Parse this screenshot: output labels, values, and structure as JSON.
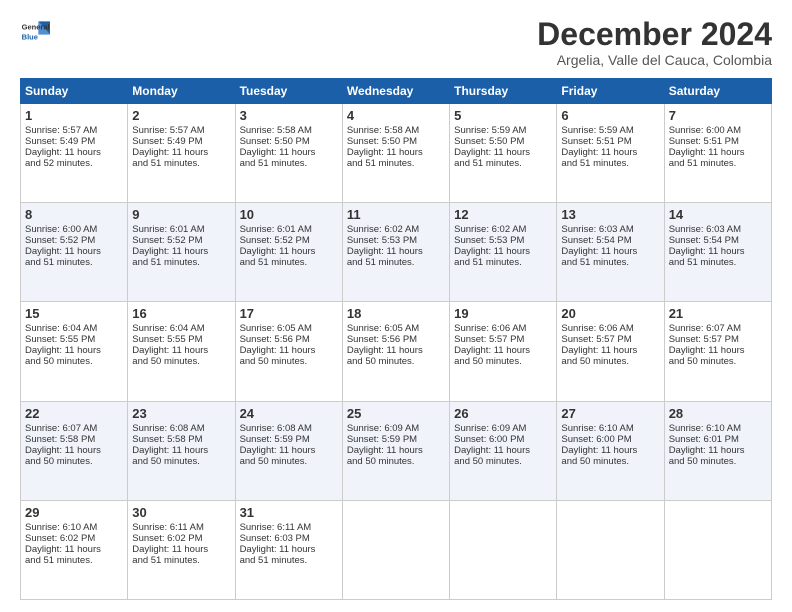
{
  "header": {
    "logo_line1": "General",
    "logo_line2": "Blue",
    "month": "December 2024",
    "location": "Argelia, Valle del Cauca, Colombia"
  },
  "days_of_week": [
    "Sunday",
    "Monday",
    "Tuesday",
    "Wednesday",
    "Thursday",
    "Friday",
    "Saturday"
  ],
  "weeks": [
    [
      {
        "day": 1,
        "lines": [
          "Sunrise: 5:57 AM",
          "Sunset: 5:49 PM",
          "Daylight: 11 hours",
          "and 52 minutes."
        ]
      },
      {
        "day": 2,
        "lines": [
          "Sunrise: 5:57 AM",
          "Sunset: 5:49 PM",
          "Daylight: 11 hours",
          "and 51 minutes."
        ]
      },
      {
        "day": 3,
        "lines": [
          "Sunrise: 5:58 AM",
          "Sunset: 5:50 PM",
          "Daylight: 11 hours",
          "and 51 minutes."
        ]
      },
      {
        "day": 4,
        "lines": [
          "Sunrise: 5:58 AM",
          "Sunset: 5:50 PM",
          "Daylight: 11 hours",
          "and 51 minutes."
        ]
      },
      {
        "day": 5,
        "lines": [
          "Sunrise: 5:59 AM",
          "Sunset: 5:50 PM",
          "Daylight: 11 hours",
          "and 51 minutes."
        ]
      },
      {
        "day": 6,
        "lines": [
          "Sunrise: 5:59 AM",
          "Sunset: 5:51 PM",
          "Daylight: 11 hours",
          "and 51 minutes."
        ]
      },
      {
        "day": 7,
        "lines": [
          "Sunrise: 6:00 AM",
          "Sunset: 5:51 PM",
          "Daylight: 11 hours",
          "and 51 minutes."
        ]
      }
    ],
    [
      {
        "day": 8,
        "lines": [
          "Sunrise: 6:00 AM",
          "Sunset: 5:52 PM",
          "Daylight: 11 hours",
          "and 51 minutes."
        ]
      },
      {
        "day": 9,
        "lines": [
          "Sunrise: 6:01 AM",
          "Sunset: 5:52 PM",
          "Daylight: 11 hours",
          "and 51 minutes."
        ]
      },
      {
        "day": 10,
        "lines": [
          "Sunrise: 6:01 AM",
          "Sunset: 5:52 PM",
          "Daylight: 11 hours",
          "and 51 minutes."
        ]
      },
      {
        "day": 11,
        "lines": [
          "Sunrise: 6:02 AM",
          "Sunset: 5:53 PM",
          "Daylight: 11 hours",
          "and 51 minutes."
        ]
      },
      {
        "day": 12,
        "lines": [
          "Sunrise: 6:02 AM",
          "Sunset: 5:53 PM",
          "Daylight: 11 hours",
          "and 51 minutes."
        ]
      },
      {
        "day": 13,
        "lines": [
          "Sunrise: 6:03 AM",
          "Sunset: 5:54 PM",
          "Daylight: 11 hours",
          "and 51 minutes."
        ]
      },
      {
        "day": 14,
        "lines": [
          "Sunrise: 6:03 AM",
          "Sunset: 5:54 PM",
          "Daylight: 11 hours",
          "and 51 minutes."
        ]
      }
    ],
    [
      {
        "day": 15,
        "lines": [
          "Sunrise: 6:04 AM",
          "Sunset: 5:55 PM",
          "Daylight: 11 hours",
          "and 50 minutes."
        ]
      },
      {
        "day": 16,
        "lines": [
          "Sunrise: 6:04 AM",
          "Sunset: 5:55 PM",
          "Daylight: 11 hours",
          "and 50 minutes."
        ]
      },
      {
        "day": 17,
        "lines": [
          "Sunrise: 6:05 AM",
          "Sunset: 5:56 PM",
          "Daylight: 11 hours",
          "and 50 minutes."
        ]
      },
      {
        "day": 18,
        "lines": [
          "Sunrise: 6:05 AM",
          "Sunset: 5:56 PM",
          "Daylight: 11 hours",
          "and 50 minutes."
        ]
      },
      {
        "day": 19,
        "lines": [
          "Sunrise: 6:06 AM",
          "Sunset: 5:57 PM",
          "Daylight: 11 hours",
          "and 50 minutes."
        ]
      },
      {
        "day": 20,
        "lines": [
          "Sunrise: 6:06 AM",
          "Sunset: 5:57 PM",
          "Daylight: 11 hours",
          "and 50 minutes."
        ]
      },
      {
        "day": 21,
        "lines": [
          "Sunrise: 6:07 AM",
          "Sunset: 5:57 PM",
          "Daylight: 11 hours",
          "and 50 minutes."
        ]
      }
    ],
    [
      {
        "day": 22,
        "lines": [
          "Sunrise: 6:07 AM",
          "Sunset: 5:58 PM",
          "Daylight: 11 hours",
          "and 50 minutes."
        ]
      },
      {
        "day": 23,
        "lines": [
          "Sunrise: 6:08 AM",
          "Sunset: 5:58 PM",
          "Daylight: 11 hours",
          "and 50 minutes."
        ]
      },
      {
        "day": 24,
        "lines": [
          "Sunrise: 6:08 AM",
          "Sunset: 5:59 PM",
          "Daylight: 11 hours",
          "and 50 minutes."
        ]
      },
      {
        "day": 25,
        "lines": [
          "Sunrise: 6:09 AM",
          "Sunset: 5:59 PM",
          "Daylight: 11 hours",
          "and 50 minutes."
        ]
      },
      {
        "day": 26,
        "lines": [
          "Sunrise: 6:09 AM",
          "Sunset: 6:00 PM",
          "Daylight: 11 hours",
          "and 50 minutes."
        ]
      },
      {
        "day": 27,
        "lines": [
          "Sunrise: 6:10 AM",
          "Sunset: 6:00 PM",
          "Daylight: 11 hours",
          "and 50 minutes."
        ]
      },
      {
        "day": 28,
        "lines": [
          "Sunrise: 6:10 AM",
          "Sunset: 6:01 PM",
          "Daylight: 11 hours",
          "and 50 minutes."
        ]
      }
    ],
    [
      {
        "day": 29,
        "lines": [
          "Sunrise: 6:10 AM",
          "Sunset: 6:02 PM",
          "Daylight: 11 hours",
          "and 51 minutes."
        ]
      },
      {
        "day": 30,
        "lines": [
          "Sunrise: 6:11 AM",
          "Sunset: 6:02 PM",
          "Daylight: 11 hours",
          "and 51 minutes."
        ]
      },
      {
        "day": 31,
        "lines": [
          "Sunrise: 6:11 AM",
          "Sunset: 6:03 PM",
          "Daylight: 11 hours",
          "and 51 minutes."
        ]
      },
      null,
      null,
      null,
      null
    ]
  ]
}
